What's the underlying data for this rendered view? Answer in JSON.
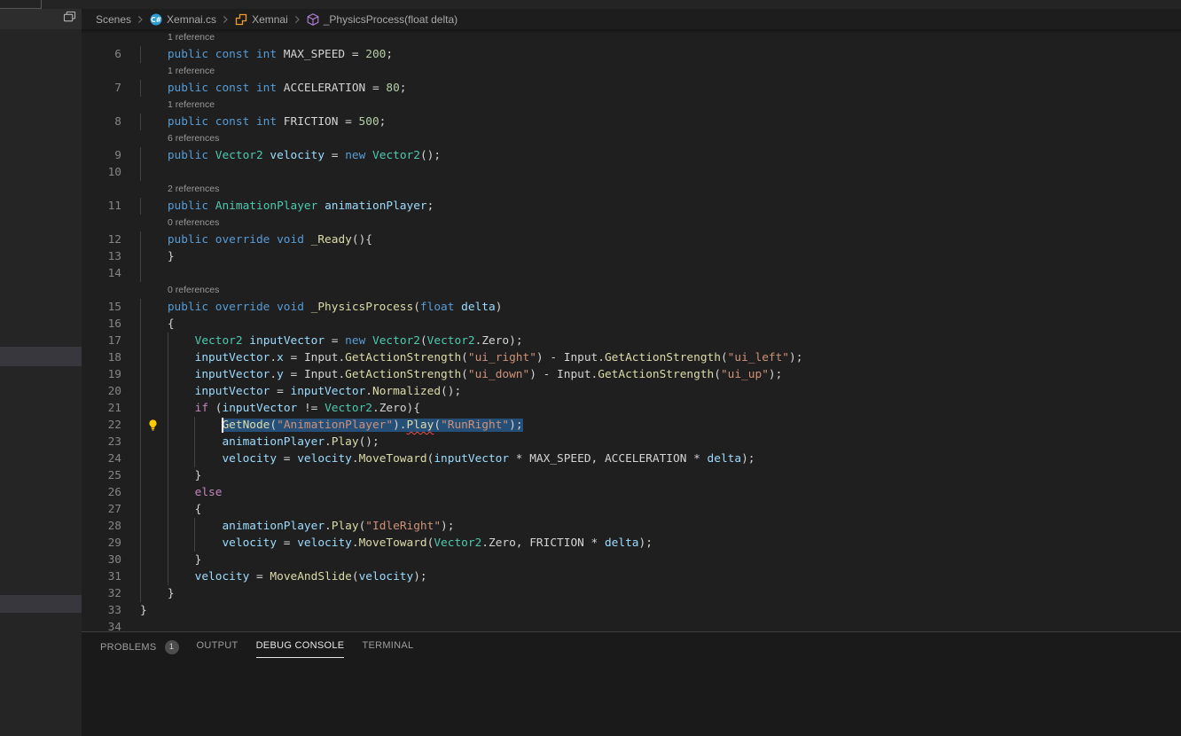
{
  "colors": {
    "kw": "#569CD6",
    "ctrl": "#C586C0",
    "type": "#4EC9B0",
    "fn": "#DCDCAA",
    "var": "#9CDCFE",
    "str": "#CE9178",
    "num": "#B5CEA8",
    "plain": "#D4D4D4",
    "selection": "#264F78",
    "squiggle": "#F14C4C",
    "lightbulb": "#FFCC00",
    "codelens": "#999999",
    "linenum": "#858585",
    "guide": "#404045",
    "editor_bg": "#1F1F1F",
    "sidebar_bg": "#252526",
    "sidebar_header_bg": "#2D2D2E",
    "sidebar_row": "#37373D",
    "topbar_bg": "#242424",
    "breadcrumb_bg": "#1D1D1E",
    "breadcrumb_text": "#A9A9A9",
    "panel_bg": "#1A1A1A",
    "panel_border": "#3E3E3E",
    "tab_active": "#E7E7E7",
    "tab_inactive": "#9D9D9D",
    "badge_bg": "#4D4D4D",
    "icon_csharp": "#2D9BD6",
    "icon_class": "#EE9D28",
    "icon_method": "#B180D7",
    "icon_chevron": "#6A6A6A",
    "icon_editor_layout": "#C5C5C5"
  },
  "breadcrumbs": {
    "items": [
      {
        "label": "Scenes",
        "icon": null
      },
      {
        "label": "Xemnai.cs",
        "icon": "csharp-file-icon"
      },
      {
        "label": "Xemnai",
        "icon": "symbol-class-icon"
      },
      {
        "label": "_PhysicsProcess(float delta)",
        "icon": "symbol-method-icon"
      }
    ]
  },
  "editor": {
    "rows": [
      {
        "type": "lens",
        "text": "1 reference"
      },
      {
        "type": "code",
        "num": "6",
        "guides": [
          0
        ],
        "segments": [
          {
            "c": "kw",
            "t": "    public const int"
          },
          {
            "c": "plain",
            "t": " MAX_SPEED = "
          },
          {
            "c": "num",
            "t": "200"
          },
          {
            "c": "plain",
            "t": ";"
          }
        ]
      },
      {
        "type": "lens",
        "text": "1 reference"
      },
      {
        "type": "code",
        "num": "7",
        "guides": [
          0
        ],
        "segments": [
          {
            "c": "kw",
            "t": "    public const int"
          },
          {
            "c": "plain",
            "t": " ACCELERATION = "
          },
          {
            "c": "num",
            "t": "80"
          },
          {
            "c": "plain",
            "t": ";"
          }
        ]
      },
      {
        "type": "lens",
        "text": "1 reference"
      },
      {
        "type": "code",
        "num": "8",
        "guides": [
          0
        ],
        "segments": [
          {
            "c": "kw",
            "t": "    public const int"
          },
          {
            "c": "plain",
            "t": " FRICTION = "
          },
          {
            "c": "num",
            "t": "500"
          },
          {
            "c": "plain",
            "t": ";"
          }
        ]
      },
      {
        "type": "lens",
        "text": "6 references"
      },
      {
        "type": "code",
        "num": "9",
        "guides": [
          0
        ],
        "segments": [
          {
            "c": "kw",
            "t": "    public"
          },
          {
            "c": "plain",
            "t": " "
          },
          {
            "c": "type",
            "t": "Vector2"
          },
          {
            "c": "plain",
            "t": " "
          },
          {
            "c": "var",
            "t": "velocity"
          },
          {
            "c": "plain",
            "t": " = "
          },
          {
            "c": "kw",
            "t": "new"
          },
          {
            "c": "plain",
            "t": " "
          },
          {
            "c": "type",
            "t": "Vector2"
          },
          {
            "c": "plain",
            "t": "();"
          }
        ]
      },
      {
        "type": "code",
        "num": "10",
        "guides": [
          0
        ],
        "segments": []
      },
      {
        "type": "lens",
        "text": "2 references"
      },
      {
        "type": "code",
        "num": "11",
        "guides": [
          0
        ],
        "segments": [
          {
            "c": "kw",
            "t": "    public"
          },
          {
            "c": "plain",
            "t": " "
          },
          {
            "c": "type",
            "t": "AnimationPlayer"
          },
          {
            "c": "plain",
            "t": " "
          },
          {
            "c": "var",
            "t": "animationPlayer"
          },
          {
            "c": "plain",
            "t": ";"
          }
        ]
      },
      {
        "type": "lens",
        "text": "0 references"
      },
      {
        "type": "code",
        "num": "12",
        "guides": [
          0
        ],
        "segments": [
          {
            "c": "kw",
            "t": "    public override void"
          },
          {
            "c": "plain",
            "t": " "
          },
          {
            "c": "fn",
            "t": "_Ready"
          },
          {
            "c": "plain",
            "t": "(){"
          }
        ]
      },
      {
        "type": "code",
        "num": "13",
        "guides": [
          0
        ],
        "segments": [
          {
            "c": "plain",
            "t": "    }"
          }
        ]
      },
      {
        "type": "code",
        "num": "14",
        "guides": [
          0
        ],
        "segments": []
      },
      {
        "type": "lens",
        "text": "0 references"
      },
      {
        "type": "code",
        "num": "15",
        "guides": [
          0
        ],
        "segments": [
          {
            "c": "kw",
            "t": "    public override void"
          },
          {
            "c": "plain",
            "t": " "
          },
          {
            "c": "fn",
            "t": "_PhysicsProcess"
          },
          {
            "c": "plain",
            "t": "("
          },
          {
            "c": "kw",
            "t": "float"
          },
          {
            "c": "plain",
            "t": " "
          },
          {
            "c": "var",
            "t": "delta"
          },
          {
            "c": "plain",
            "t": ")"
          }
        ]
      },
      {
        "type": "code",
        "num": "16",
        "guides": [
          0
        ],
        "segments": [
          {
            "c": "plain",
            "t": "    {"
          }
        ]
      },
      {
        "type": "code",
        "num": "17",
        "guides": [
          0,
          1
        ],
        "segments": [
          {
            "c": "plain",
            "t": "        "
          },
          {
            "c": "type",
            "t": "Vector2"
          },
          {
            "c": "plain",
            "t": " "
          },
          {
            "c": "var",
            "t": "inputVector"
          },
          {
            "c": "plain",
            "t": " = "
          },
          {
            "c": "kw",
            "t": "new"
          },
          {
            "c": "plain",
            "t": " "
          },
          {
            "c": "type",
            "t": "Vector2"
          },
          {
            "c": "plain",
            "t": "("
          },
          {
            "c": "type",
            "t": "Vector2"
          },
          {
            "c": "plain",
            "t": ".Zero);"
          }
        ]
      },
      {
        "type": "code",
        "num": "18",
        "guides": [
          0,
          1
        ],
        "segments": [
          {
            "c": "plain",
            "t": "        "
          },
          {
            "c": "var",
            "t": "inputVector"
          },
          {
            "c": "plain",
            "t": "."
          },
          {
            "c": "var",
            "t": "x"
          },
          {
            "c": "plain",
            "t": " = Input."
          },
          {
            "c": "fn",
            "t": "GetActionStrength"
          },
          {
            "c": "plain",
            "t": "("
          },
          {
            "c": "str",
            "t": "\"ui_right\""
          },
          {
            "c": "plain",
            "t": ") - Input."
          },
          {
            "c": "fn",
            "t": "GetActionStrength"
          },
          {
            "c": "plain",
            "t": "("
          },
          {
            "c": "str",
            "t": "\"ui_left\""
          },
          {
            "c": "plain",
            "t": ");"
          }
        ]
      },
      {
        "type": "code",
        "num": "19",
        "guides": [
          0,
          1
        ],
        "segments": [
          {
            "c": "plain",
            "t": "        "
          },
          {
            "c": "var",
            "t": "inputVector"
          },
          {
            "c": "plain",
            "t": "."
          },
          {
            "c": "var",
            "t": "y"
          },
          {
            "c": "plain",
            "t": " = Input."
          },
          {
            "c": "fn",
            "t": "GetActionStrength"
          },
          {
            "c": "plain",
            "t": "("
          },
          {
            "c": "str",
            "t": "\"ui_down\""
          },
          {
            "c": "plain",
            "t": ") - Input."
          },
          {
            "c": "fn",
            "t": "GetActionStrength"
          },
          {
            "c": "plain",
            "t": "("
          },
          {
            "c": "str",
            "t": "\"ui_up\""
          },
          {
            "c": "plain",
            "t": ");"
          }
        ]
      },
      {
        "type": "code",
        "num": "20",
        "guides": [
          0,
          1
        ],
        "segments": [
          {
            "c": "plain",
            "t": "        "
          },
          {
            "c": "var",
            "t": "inputVector"
          },
          {
            "c": "plain",
            "t": " = "
          },
          {
            "c": "var",
            "t": "inputVector"
          },
          {
            "c": "plain",
            "t": "."
          },
          {
            "c": "fn",
            "t": "Normalized"
          },
          {
            "c": "plain",
            "t": "();"
          }
        ]
      },
      {
        "type": "code",
        "num": "21",
        "guides": [
          0,
          1
        ],
        "segments": [
          {
            "c": "plain",
            "t": "        "
          },
          {
            "c": "ctrl",
            "t": "if"
          },
          {
            "c": "plain",
            "t": " ("
          },
          {
            "c": "var",
            "t": "inputVector"
          },
          {
            "c": "plain",
            "t": " != "
          },
          {
            "c": "type",
            "t": "Vector2"
          },
          {
            "c": "plain",
            "t": ".Zero){"
          }
        ]
      },
      {
        "type": "code",
        "num": "22",
        "guides": [
          0,
          1,
          2
        ],
        "lightbulb": true,
        "caret_col": 12,
        "segments": [
          {
            "c": "plain",
            "t": "            "
          },
          {
            "c": "fn",
            "t": "GetNode",
            "sel": true
          },
          {
            "c": "plain",
            "t": "(",
            "sel": true
          },
          {
            "c": "str",
            "t": "\"AnimationPlayer\"",
            "sel": true
          },
          {
            "c": "plain",
            "t": ").",
            "sel": true
          },
          {
            "c": "fn",
            "t": "Play",
            "sel": true,
            "sq": true
          },
          {
            "c": "plain",
            "t": "(",
            "sel": true
          },
          {
            "c": "str",
            "t": "\"RunRight\"",
            "sel": true
          },
          {
            "c": "plain",
            "t": ");",
            "sel": true
          }
        ]
      },
      {
        "type": "code",
        "num": "23",
        "guides": [
          0,
          1,
          2
        ],
        "segments": [
          {
            "c": "plain",
            "t": "            "
          },
          {
            "c": "var",
            "t": "animationPlayer"
          },
          {
            "c": "plain",
            "t": "."
          },
          {
            "c": "fn",
            "t": "Play"
          },
          {
            "c": "plain",
            "t": "();"
          }
        ]
      },
      {
        "type": "code",
        "num": "24",
        "guides": [
          0,
          1,
          2
        ],
        "segments": [
          {
            "c": "plain",
            "t": "            "
          },
          {
            "c": "var",
            "t": "velocity"
          },
          {
            "c": "plain",
            "t": " = "
          },
          {
            "c": "var",
            "t": "velocity"
          },
          {
            "c": "plain",
            "t": "."
          },
          {
            "c": "fn",
            "t": "MoveToward"
          },
          {
            "c": "plain",
            "t": "("
          },
          {
            "c": "var",
            "t": "inputVector"
          },
          {
            "c": "plain",
            "t": " * MAX_SPEED, ACCELERATION * "
          },
          {
            "c": "var",
            "t": "delta"
          },
          {
            "c": "plain",
            "t": ");"
          }
        ]
      },
      {
        "type": "code",
        "num": "25",
        "guides": [
          0,
          1
        ],
        "segments": [
          {
            "c": "plain",
            "t": "        }"
          }
        ]
      },
      {
        "type": "code",
        "num": "26",
        "guides": [
          0,
          1
        ],
        "segments": [
          {
            "c": "plain",
            "t": "        "
          },
          {
            "c": "ctrl",
            "t": "else"
          }
        ]
      },
      {
        "type": "code",
        "num": "27",
        "guides": [
          0,
          1
        ],
        "segments": [
          {
            "c": "plain",
            "t": "        {"
          }
        ]
      },
      {
        "type": "code",
        "num": "28",
        "guides": [
          0,
          1,
          2
        ],
        "segments": [
          {
            "c": "plain",
            "t": "            "
          },
          {
            "c": "var",
            "t": "animationPlayer"
          },
          {
            "c": "plain",
            "t": "."
          },
          {
            "c": "fn",
            "t": "Play"
          },
          {
            "c": "plain",
            "t": "("
          },
          {
            "c": "str",
            "t": "\"IdleRight\""
          },
          {
            "c": "plain",
            "t": ");"
          }
        ]
      },
      {
        "type": "code",
        "num": "29",
        "guides": [
          0,
          1,
          2
        ],
        "segments": [
          {
            "c": "plain",
            "t": "            "
          },
          {
            "c": "var",
            "t": "velocity"
          },
          {
            "c": "plain",
            "t": " = "
          },
          {
            "c": "var",
            "t": "velocity"
          },
          {
            "c": "plain",
            "t": "."
          },
          {
            "c": "fn",
            "t": "MoveToward"
          },
          {
            "c": "plain",
            "t": "("
          },
          {
            "c": "type",
            "t": "Vector2"
          },
          {
            "c": "plain",
            "t": ".Zero, FRICTION * "
          },
          {
            "c": "var",
            "t": "delta"
          },
          {
            "c": "plain",
            "t": ");"
          }
        ]
      },
      {
        "type": "code",
        "num": "30",
        "guides": [
          0,
          1
        ],
        "segments": [
          {
            "c": "plain",
            "t": "        }"
          }
        ]
      },
      {
        "type": "code",
        "num": "31",
        "guides": [
          0,
          1
        ],
        "segments": [
          {
            "c": "plain",
            "t": "        "
          },
          {
            "c": "var",
            "t": "velocity"
          },
          {
            "c": "plain",
            "t": " = "
          },
          {
            "c": "fn",
            "t": "MoveAndSlide"
          },
          {
            "c": "plain",
            "t": "("
          },
          {
            "c": "var",
            "t": "velocity"
          },
          {
            "c": "plain",
            "t": ");"
          }
        ]
      },
      {
        "type": "code",
        "num": "32",
        "guides": [
          0
        ],
        "segments": [
          {
            "c": "plain",
            "t": "    }"
          }
        ]
      },
      {
        "type": "code",
        "num": "33",
        "guides": [],
        "segments": [
          {
            "c": "plain",
            "t": "}"
          }
        ]
      },
      {
        "type": "code",
        "num": "34",
        "guides": [],
        "segments": []
      }
    ]
  },
  "panel": {
    "tabs": [
      {
        "label": "PROBLEMS",
        "badge": "1",
        "active": false
      },
      {
        "label": "OUTPUT",
        "active": false
      },
      {
        "label": "DEBUG CONSOLE",
        "active": true
      },
      {
        "label": "TERMINAL",
        "active": false
      }
    ]
  }
}
